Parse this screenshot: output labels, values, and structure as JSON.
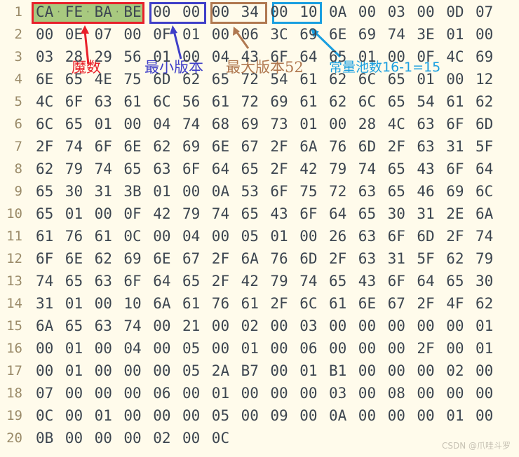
{
  "hex_rows": [
    [
      "CA",
      "FE",
      "BA",
      "BE",
      "00",
      "00",
      "00",
      "34",
      "00",
      "10",
      "0A",
      "00",
      "03",
      "00",
      "0D",
      "07"
    ],
    [
      "00",
      "0E",
      "07",
      "00",
      "0F",
      "01",
      "00",
      "06",
      "3C",
      "69",
      "6E",
      "69",
      "74",
      "3E",
      "01",
      "00"
    ],
    [
      "03",
      "28",
      "29",
      "56",
      "01",
      "00",
      "04",
      "43",
      "6F",
      "64",
      "65",
      "01",
      "00",
      "0F",
      "4C",
      "69"
    ],
    [
      "6E",
      "65",
      "4E",
      "75",
      "6D",
      "62",
      "65",
      "72",
      "54",
      "61",
      "62",
      "6C",
      "65",
      "01",
      "00",
      "12"
    ],
    [
      "4C",
      "6F",
      "63",
      "61",
      "6C",
      "56",
      "61",
      "72",
      "69",
      "61",
      "62",
      "6C",
      "65",
      "54",
      "61",
      "62"
    ],
    [
      "6C",
      "65",
      "01",
      "00",
      "04",
      "74",
      "68",
      "69",
      "73",
      "01",
      "00",
      "28",
      "4C",
      "63",
      "6F",
      "6D"
    ],
    [
      "2F",
      "74",
      "6F",
      "6E",
      "62",
      "69",
      "6E",
      "67",
      "2F",
      "6A",
      "76",
      "6D",
      "2F",
      "63",
      "31",
      "5F"
    ],
    [
      "62",
      "79",
      "74",
      "65",
      "63",
      "6F",
      "64",
      "65",
      "2F",
      "42",
      "79",
      "74",
      "65",
      "43",
      "6F",
      "64"
    ],
    [
      "65",
      "30",
      "31",
      "3B",
      "01",
      "00",
      "0A",
      "53",
      "6F",
      "75",
      "72",
      "63",
      "65",
      "46",
      "69",
      "6C"
    ],
    [
      "65",
      "01",
      "00",
      "0F",
      "42",
      "79",
      "74",
      "65",
      "43",
      "6F",
      "64",
      "65",
      "30",
      "31",
      "2E",
      "6A"
    ],
    [
      "61",
      "76",
      "61",
      "0C",
      "00",
      "04",
      "00",
      "05",
      "01",
      "00",
      "26",
      "63",
      "6F",
      "6D",
      "2F",
      "74"
    ],
    [
      "6F",
      "6E",
      "62",
      "69",
      "6E",
      "67",
      "2F",
      "6A",
      "76",
      "6D",
      "2F",
      "63",
      "31",
      "5F",
      "62",
      "79"
    ],
    [
      "74",
      "65",
      "63",
      "6F",
      "64",
      "65",
      "2F",
      "42",
      "79",
      "74",
      "65",
      "43",
      "6F",
      "64",
      "65",
      "30"
    ],
    [
      "31",
      "01",
      "00",
      "10",
      "6A",
      "61",
      "76",
      "61",
      "2F",
      "6C",
      "61",
      "6E",
      "67",
      "2F",
      "4F",
      "62"
    ],
    [
      "6A",
      "65",
      "63",
      "74",
      "00",
      "21",
      "00",
      "02",
      "00",
      "03",
      "00",
      "00",
      "00",
      "00",
      "00",
      "01"
    ],
    [
      "00",
      "01",
      "00",
      "04",
      "00",
      "05",
      "00",
      "01",
      "00",
      "06",
      "00",
      "00",
      "00",
      "2F",
      "00",
      "01"
    ],
    [
      "00",
      "01",
      "00",
      "00",
      "00",
      "05",
      "2A",
      "B7",
      "00",
      "01",
      "B1",
      "00",
      "00",
      "00",
      "02",
      "00"
    ],
    [
      "07",
      "00",
      "00",
      "00",
      "06",
      "00",
      "01",
      "00",
      "00",
      "00",
      "03",
      "00",
      "08",
      "00",
      "00",
      "00"
    ],
    [
      "0C",
      "00",
      "01",
      "00",
      "00",
      "00",
      "05",
      "00",
      "09",
      "00",
      "0A",
      "00",
      "00",
      "00",
      "01",
      "00"
    ],
    [
      "0B",
      "00",
      "00",
      "00",
      "02",
      "00",
      "0C"
    ]
  ],
  "annotations": {
    "magic": {
      "label": "魔数",
      "color": "#e8202a",
      "fill": "#a8c97f"
    },
    "minor_version": {
      "label": "最小版本",
      "color": "#3f3fc8"
    },
    "major_version": {
      "label": "最大版本52",
      "color": "#b07850"
    },
    "constant_pool_count": {
      "label": "常量池数16-1=15",
      "color": "#1a9fe0"
    }
  },
  "watermark": "CSDN @爪哇斗罗"
}
